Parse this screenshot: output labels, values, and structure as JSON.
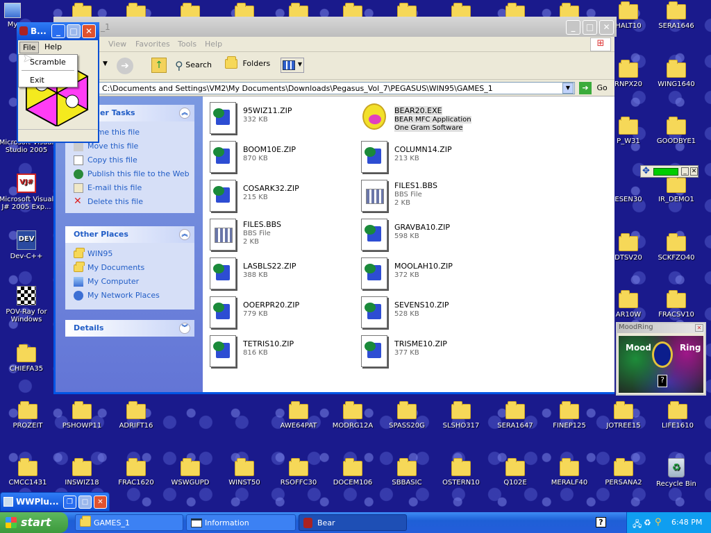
{
  "desktop": {
    "left_icons": [
      {
        "label": "My",
        "type": "app"
      },
      {
        "label": "Microsoft Visual Studio 2005",
        "type": "app"
      },
      {
        "label": "Microsoft Visual J# 2005 Exp...",
        "type": "app"
      },
      {
        "label": "Dev-C++",
        "type": "app"
      },
      {
        "label": "POV-Ray for Windows",
        "type": "app"
      },
      {
        "label": "CHIEFA35",
        "type": "folder"
      }
    ],
    "right_icons": [
      "HALT10",
      "SERA1646",
      "RNPX20",
      "WING1640",
      "P_W31",
      "GOODBYE1",
      "ESEN30",
      "IR_DEMO1",
      "DTSV20",
      "SCKFZO40",
      "AR10W",
      "FRACSV10"
    ],
    "row1": [
      "PROZEIT",
      "PSHOWP11",
      "ADRIFT16",
      "AWE64PAT",
      "MODRG12A",
      "SPASS20G",
      "SLSHO317",
      "SERA1647",
      "FINEP125",
      "JOTREE15",
      "LIFE1610"
    ],
    "row2": [
      "CMCC1431",
      "INSWIZ18",
      "FRAC1620",
      "WSWGUPD",
      "WINST50",
      "RSOFFC30",
      "DOCEM106",
      "SBBASIC",
      "OSTERN10",
      "Q102E",
      "MERALF40",
      "PERSANA2",
      "Recycle Bin"
    ]
  },
  "explorer": {
    "title": "_1",
    "menu": [
      "View",
      "Favorites",
      "Tools",
      "Help"
    ],
    "toolbar": {
      "search": "Search",
      "folders": "Folders"
    },
    "address": {
      "path": "C:\\Documents and Settings\\VM2\\My Documents\\Downloads\\Pegasus_Vol_7\\PEGASUS\\WIN95\\GAMES_1",
      "go": "Go"
    },
    "file_tasks": {
      "title": "d Folder Tasks",
      "items": [
        "name this file",
        "Move this file",
        "Copy this file",
        "Publish this file to the Web",
        "E-mail this file",
        "Delete this file"
      ]
    },
    "other_places": {
      "title": "Other Places",
      "items": [
        "WIN95",
        "My Documents",
        "My Computer",
        "My Network Places"
      ]
    },
    "details": {
      "title": "Details"
    },
    "files": [
      {
        "name": "95WIZ11.ZIP",
        "info": "332 KB",
        "kind": "zip"
      },
      {
        "name": "BEAR20.EXE",
        "info": "BEAR MFC Application",
        "info2": "One Gram Software",
        "kind": "exe"
      },
      {
        "name": "BOOM10E.ZIP",
        "info": "870 KB",
        "kind": "zip"
      },
      {
        "name": "COLUMN14.ZIP",
        "info": "213 KB",
        "kind": "zip"
      },
      {
        "name": "COSARK32.ZIP",
        "info": "215 KB",
        "kind": "zip"
      },
      {
        "name": "FILES1.BBS",
        "info": "BBS File",
        "info2": "2 KB",
        "kind": "bbs"
      },
      {
        "name": "FILES.BBS",
        "info": "BBS File",
        "info2": "2 KB",
        "kind": "bbs"
      },
      {
        "name": "GRAVBA10.ZIP",
        "info": "598 KB",
        "kind": "zip"
      },
      {
        "name": "LASBLS22.ZIP",
        "info": "388 KB",
        "kind": "zip"
      },
      {
        "name": "MOOLAH10.ZIP",
        "info": "372 KB",
        "kind": "zip"
      },
      {
        "name": "OOERPR20.ZIP",
        "info": "779 KB",
        "kind": "zip"
      },
      {
        "name": "SEVENS10.ZIP",
        "info": "528 KB",
        "kind": "zip"
      },
      {
        "name": "TETRIS10.ZIP",
        "info": "816 KB",
        "kind": "zip"
      },
      {
        "name": "TRISME10.ZIP",
        "info": "377 KB",
        "kind": "zip"
      }
    ]
  },
  "bear_app": {
    "title": "B...",
    "menu": {
      "file": "File",
      "help": "Help"
    },
    "file_menu": [
      "Scramble",
      "Exit"
    ]
  },
  "moodring": {
    "title": "MoodRing",
    "label_left": "Mood",
    "label_right": "Ring",
    "button": "?"
  },
  "mini_window": {
    "title": "WWPlu..."
  },
  "taskbar": {
    "start": "start",
    "items": [
      "GAMES_1",
      "Information",
      "Bear"
    ],
    "clock": "6:48 PM"
  },
  "colors": {
    "xp_blue": "#0055e5",
    "task_blue": "#215dc6",
    "start_green": "#3c9a3c"
  }
}
